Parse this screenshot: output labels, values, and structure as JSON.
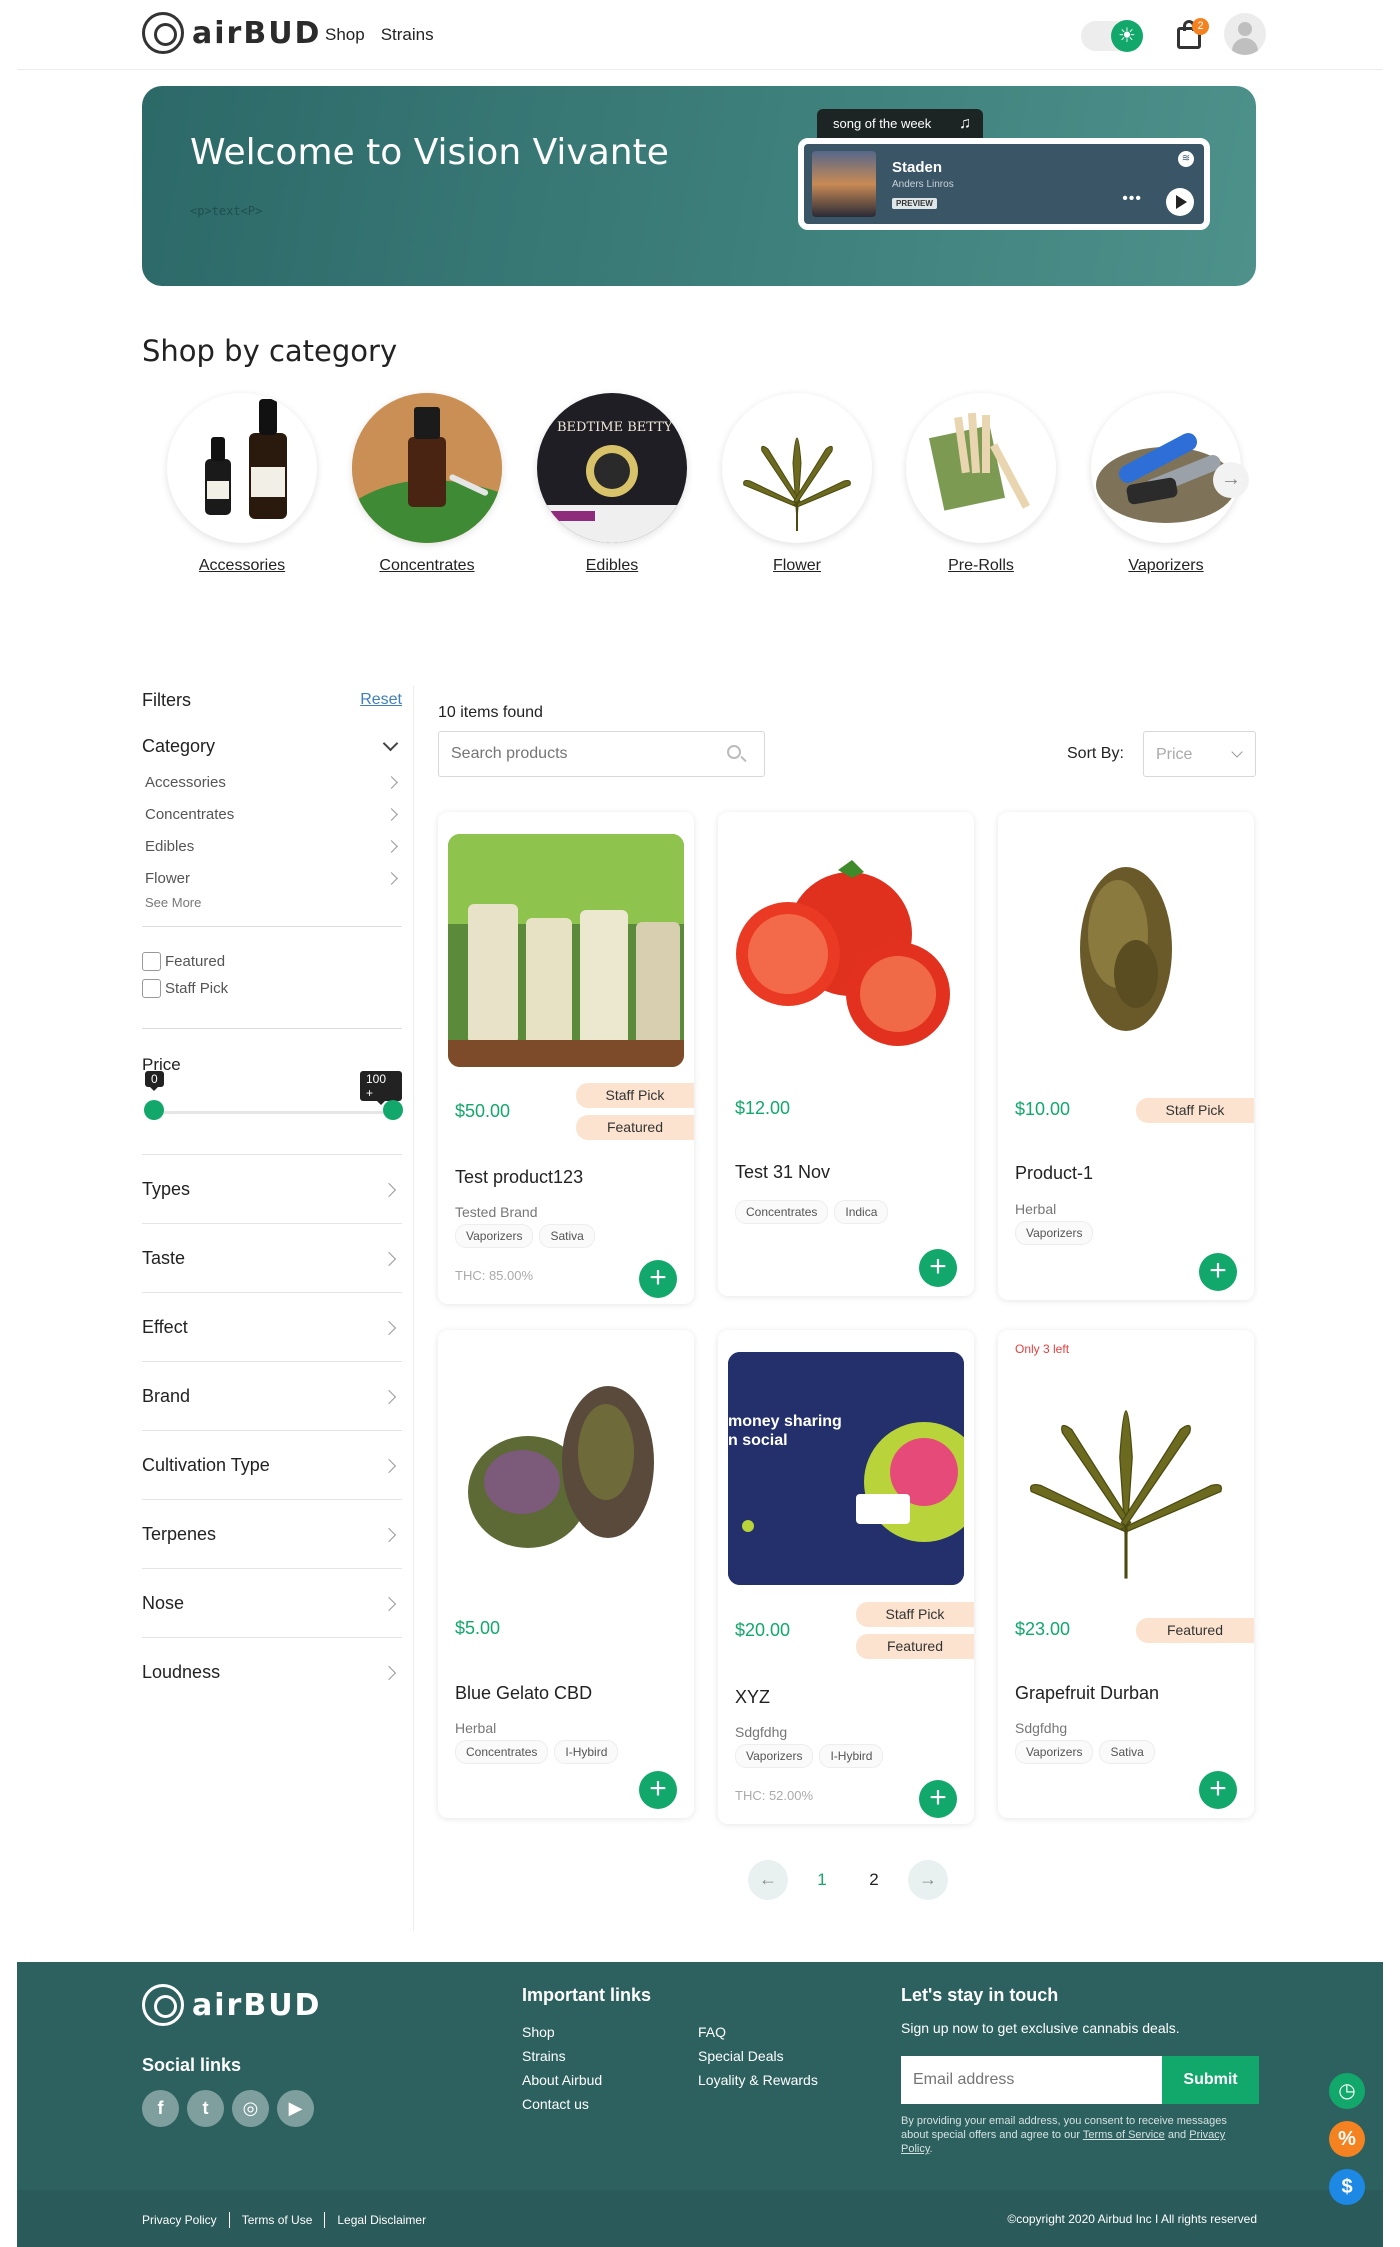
{
  "brand": {
    "name": "airBUD"
  },
  "nav": {
    "shop": "Shop",
    "strains": "Strains"
  },
  "header": {
    "theme_icon": "sun-icon",
    "cart_count": "2"
  },
  "hero": {
    "title": "Welcome to Vision Vivante",
    "subtitle": "<p>text<P>",
    "song_tag": "song of the week",
    "song": {
      "title": "Staden",
      "artist": "Anders Linros",
      "badge": "PREVIEW"
    }
  },
  "categories_section": {
    "title": "Shop by category",
    "items": [
      {
        "label": "Accessories"
      },
      {
        "label": "Concentrates"
      },
      {
        "label": "Edibles"
      },
      {
        "label": "Flower"
      },
      {
        "label": "Pre-Rolls"
      },
      {
        "label": "Vaporizers"
      }
    ]
  },
  "filters": {
    "title": "Filters",
    "reset": "Reset",
    "category_head": "Category",
    "category_items": [
      "Accessories",
      "Concentrates",
      "Edibles",
      "Flower"
    ],
    "see_more": "See More",
    "checkboxes": [
      "Featured",
      "Staff Pick"
    ],
    "price_label": "Price",
    "price_min": "0",
    "price_max": "100 +",
    "facets": [
      "Types",
      "Taste",
      "Effect",
      "Brand",
      "Cultivation Type",
      "Terpenes",
      "Nose",
      "Loudness"
    ]
  },
  "listing": {
    "count": "10 items found",
    "search_placeholder": "Search products",
    "sort_label": "Sort By:",
    "sort_value": "Price"
  },
  "products": [
    {
      "price": "$50.00",
      "tags": [
        "Staff Pick",
        "Featured"
      ],
      "name": "Test product123",
      "brand": "Tested Brand",
      "chips": [
        "Vaporizers",
        "Sativa"
      ],
      "thc": "THC: 85.00%"
    },
    {
      "price": "$12.00",
      "tags": [],
      "name": "Test 31 Nov",
      "brand": "",
      "chips": [
        "Concentrates",
        "Indica"
      ],
      "thc": ""
    },
    {
      "price": "$10.00",
      "tags": [
        "Staff Pick"
      ],
      "name": "Product-1",
      "brand": "Herbal",
      "chips": [
        "Vaporizers"
      ],
      "thc": ""
    },
    {
      "price": "$5.00",
      "tags": [],
      "name": "Blue Gelato CBD",
      "brand": "Herbal",
      "chips": [
        "Concentrates",
        "I-Hybird"
      ],
      "thc": ""
    },
    {
      "price": "$20.00",
      "tags": [
        "Staff Pick",
        "Featured"
      ],
      "name": "XYZ",
      "brand": "Sdgfdhg",
      "chips": [
        "Vaporizers",
        "I-Hybird"
      ],
      "thc": "THC: 52.00%",
      "image_text": [
        "money sharing",
        "n social"
      ]
    },
    {
      "price": "$23.00",
      "tags": [
        "Featured"
      ],
      "name": "Grapefruit Durban",
      "brand": "Sdgfdhg",
      "chips": [
        "Vaporizers",
        "Sativa"
      ],
      "thc": "",
      "stock_note": "Only 3 left"
    }
  ],
  "pagination": {
    "pages": [
      "1",
      "2"
    ],
    "current": "1",
    "prev": "←",
    "next": "→"
  },
  "footer": {
    "social_title": "Social links",
    "important_title": "Important links",
    "links_col1": [
      "Shop",
      "Strains",
      "About Airbud",
      "Contact us"
    ],
    "links_col2": [
      "FAQ",
      "Special Deals",
      "Loyality & Rewards"
    ],
    "touch_title": "Let's stay in touch",
    "touch_sub": "Sign up now to get exclusive cannabis deals.",
    "email_placeholder": "Email address",
    "submit": "Submit",
    "consent_pre": "By providing your email address, you consent to receive messages about special offers and agree to our ",
    "consent_tos": "Terms of Service",
    "consent_and": " and ",
    "consent_privacy": "Privacy Policy",
    "consent_end": ".",
    "legal": [
      "Privacy Policy",
      "Terms of Use",
      "Legal Disclaimer"
    ],
    "copyright": "©copyright 2020 Airbud Inc I All rights reserved"
  },
  "colors": {
    "accent": "#13a86b",
    "footer": "#2d6160",
    "tag": "#fbe3cf",
    "fab_orange": "#f58220",
    "fab_blue": "#1e88e5"
  }
}
